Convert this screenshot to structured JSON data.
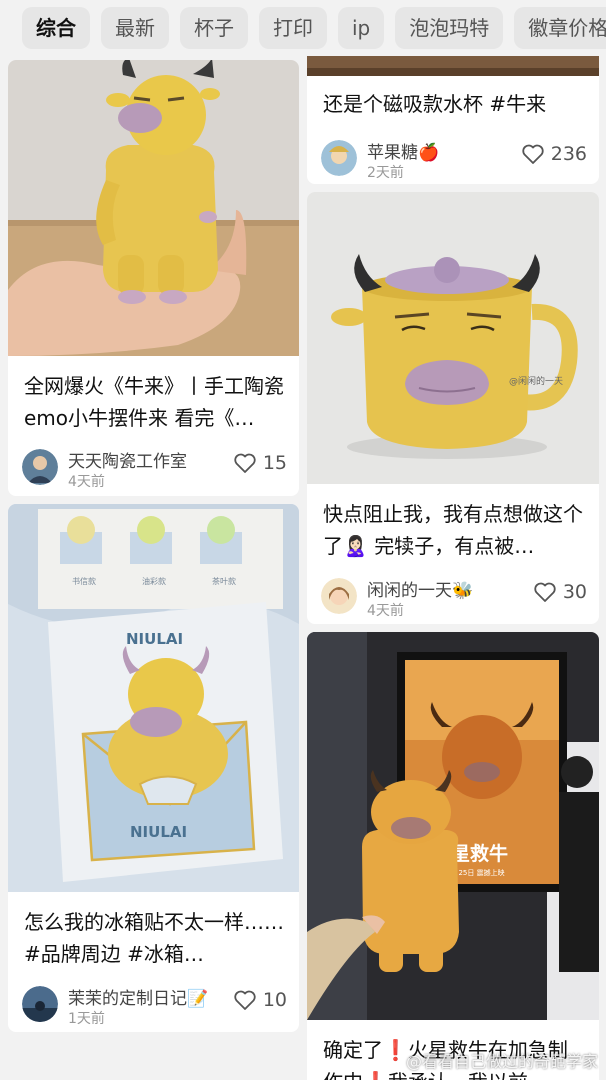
{
  "tabs": [
    "综合",
    "最新",
    "杯子",
    "打印",
    "ip",
    "泡泡玛特",
    "徽章价格"
  ],
  "cards": [
    {
      "title": "全网爆火《牛来》丨手工陶瓷emo小牛摆件来 看完《…",
      "author": "天天陶瓷工作室",
      "time": "4天前",
      "likes": "15"
    },
    {
      "title": "还是个磁吸款水杯 #牛来",
      "author": "苹果糖🍎",
      "time": "2天前",
      "likes": "236"
    },
    {
      "title": "快点阻止我，我有点想做这个了🙎🏻‍♀️ 完犊子，有点被…",
      "author": "闲闲的一天🐝",
      "time": "4天前",
      "likes": "30",
      "image_watermark": "@闲闲的一天"
    },
    {
      "title": "怎么我的冰箱贴不太一样……#品牌周边 #冰箱…",
      "author": "茉茉的定制日记📝",
      "time": "1天前",
      "likes": "10",
      "image_text": [
        "书信款",
        "油彩款",
        "茶叶款",
        "NIULAI",
        "NIULAI"
      ]
    },
    {
      "title": "确定了❗️火星救牛在加急制作中❗️我承认，我以前…",
      "poster": [
        "火星救牛",
        "2月25日 震撼上映"
      ]
    }
  ],
  "watermark": "@看看自己做过的奇葩学家",
  "colors": {
    "background": "#f2f2f2",
    "card": "#ffffff",
    "tab_bg": "#e6e6e6",
    "ox_yellow": "#e9c84a",
    "ox_lip": "#b79ab8"
  }
}
